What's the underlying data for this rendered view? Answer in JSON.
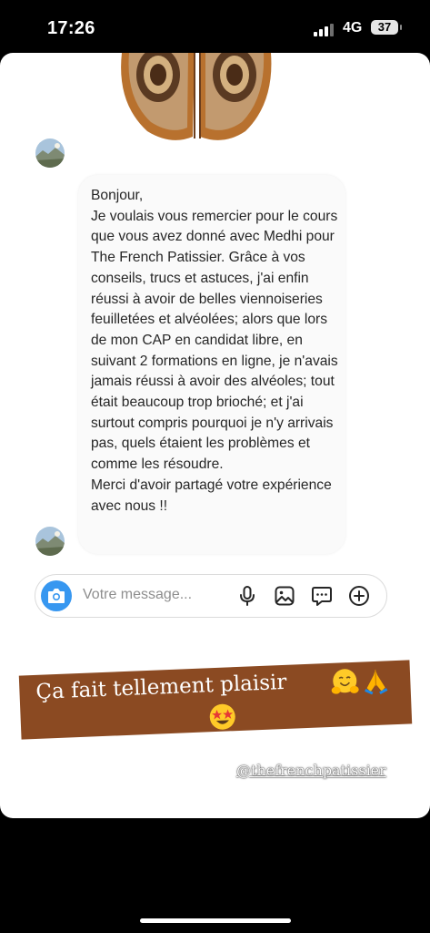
{
  "status_bar": {
    "time": "17:26",
    "network": "4G",
    "battery": "37"
  },
  "message": {
    "text": "Bonjour,\nJe voulais vous remercier pour le cours que vous avez donné avec Medhi pour The French Patissier. Grâce à vos conseils, trucs et astuces, j'ai enfin réussi à avoir de belles viennoiseries feuilletées et alvéolées; alors que lors de mon CAP en candidat libre, en suivant 2 formations en ligne, je n'avais jamais réussi à avoir des alvéoles; tout était beaucoup trop brioché; et j'ai surtout compris pourquoi je n'y arrivais pas, quels étaient les problèmes et comme les résoudre.\nMerci d'avoir partagé votre expérience avec nous !!"
  },
  "composer": {
    "placeholder": "Votre message...",
    "icons": [
      "camera-icon",
      "microphone-icon",
      "gallery-icon",
      "sticker-icon",
      "plus-icon"
    ]
  },
  "story": {
    "caption": "Ça fait tellement plaisir",
    "emojis": [
      "hugging-face",
      "folded-hands",
      "star-struck"
    ],
    "mention": "@thefrenchpatissier",
    "caption_bg": "#8b4a22"
  },
  "colors": {
    "accent": "#3797f0",
    "background": "#000000",
    "card": "#ffffff"
  }
}
